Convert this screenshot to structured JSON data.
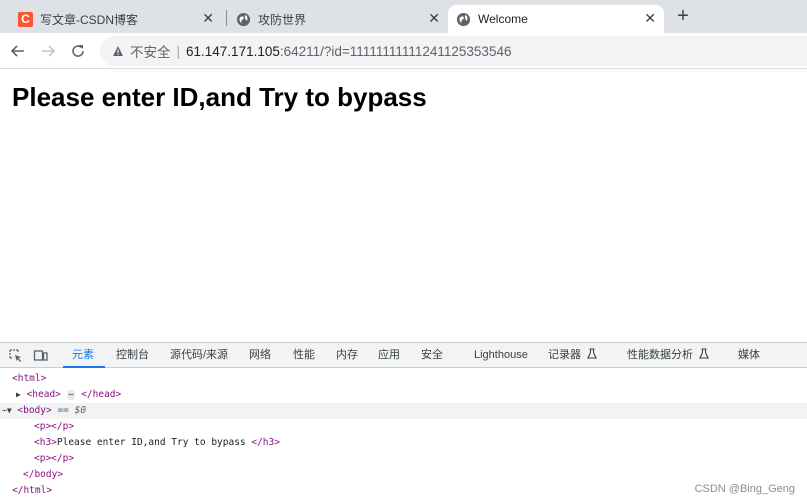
{
  "tabs": [
    {
      "title": "写文章-CSDN博客",
      "favicon": "csdn-icon",
      "favicon_text": "C",
      "active": false
    },
    {
      "title": "攻防世界",
      "favicon": "globe-icon",
      "active": false
    },
    {
      "title": "Welcome",
      "favicon": "globe-icon",
      "active": true
    }
  ],
  "new_tab_label": "+",
  "close_glyph": "✕",
  "address": {
    "insecure_label": "不安全",
    "separator": "|",
    "host": "61.147.171.105",
    "rest": ":64211/?id=11111111111241125353546"
  },
  "page": {
    "heading": "Please enter ID,and Try to bypass"
  },
  "devtools": {
    "tabs": [
      {
        "label": "元素",
        "active": true
      },
      {
        "label": "控制台"
      },
      {
        "label": "源代码/来源"
      },
      {
        "label": "网络"
      },
      {
        "label": "性能"
      },
      {
        "label": "内存"
      },
      {
        "label": "应用"
      },
      {
        "label": "安全"
      },
      {
        "label": "Lighthouse"
      },
      {
        "label": "记录器"
      },
      {
        "label": "性能数据分析"
      },
      {
        "label": "媒体"
      }
    ],
    "dom": {
      "html_open": "<html>",
      "head_open": "<head>",
      "head_ellipsis": "⋯",
      "head_close": "</head>",
      "body_open": "<body>",
      "body_ref": "== $0",
      "p1": "<p></p>",
      "h3_open": "<h3>",
      "h3_text": "Please enter ID,and Try to bypass ",
      "h3_close": "</h3>",
      "p2": "<p></p>",
      "body_close": "</body>",
      "html_close": "</html>"
    }
  },
  "watermark": "CSDN @Bing_Geng",
  "colors": {
    "accent": "#1a73e8",
    "csdn_red": "#fc5531",
    "tag_purple": "#881280"
  }
}
